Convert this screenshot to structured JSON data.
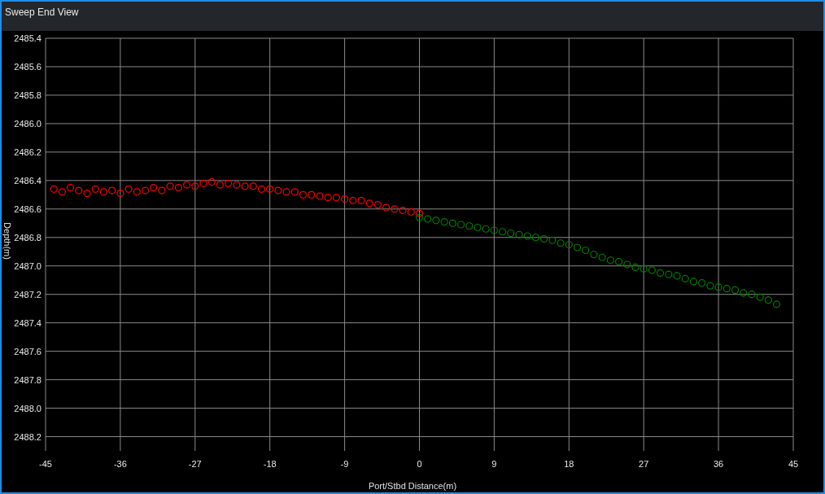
{
  "window": {
    "title": "Sweep End View"
  },
  "chart": {
    "chart_data": {
      "type": "scatter",
      "grid": true,
      "xlabel": "Port/Stbd Distance(m)",
      "ylabel": "Depth(m)",
      "xlim": [
        -45,
        45
      ],
      "ylim": [
        2488.3,
        2485.4
      ],
      "xticks": [
        -45,
        -36,
        -27,
        -18,
        -9,
        0,
        9,
        18,
        27,
        36,
        45
      ],
      "yticks": [
        {
          "value": 2485.4,
          "label": "2485.4"
        },
        {
          "value": 2485.6,
          "label": "2485.6"
        },
        {
          "value": 2485.8,
          "label": "2485.8"
        },
        {
          "value": 2486.0,
          "label": "2486.0"
        },
        {
          "value": 2486.2,
          "label": "2486.2"
        },
        {
          "value": 2486.4,
          "label": "2486.4"
        },
        {
          "value": 2486.6,
          "label": "2486.6"
        },
        {
          "value": 2486.8,
          "label": "2486.8"
        },
        {
          "value": 2487.0,
          "label": "2487.0"
        },
        {
          "value": 2487.2,
          "label": "2487.2"
        },
        {
          "value": 2487.4,
          "label": "2487.4"
        },
        {
          "value": 2487.6,
          "label": "2487.6"
        },
        {
          "value": 2487.8,
          "label": "2487.8"
        },
        {
          "value": 2488.0,
          "label": "2488.0"
        },
        {
          "value": 2488.2,
          "label": "2488.2"
        }
      ],
      "x": [
        -44,
        -43,
        -42,
        -41,
        -40,
        -39,
        -38,
        -37,
        -36,
        -35,
        -34,
        -33,
        -32,
        -31,
        -30,
        -29,
        -28,
        -27,
        -26,
        -25,
        -24,
        -23,
        -22,
        -21,
        -20,
        -19,
        -18,
        -17,
        -16,
        -15,
        -14,
        -13,
        -12,
        -11,
        -10,
        -9,
        -8,
        -7,
        -6,
        -5,
        -4,
        -3,
        -2,
        -1,
        0,
        1,
        2,
        3,
        4,
        5,
        6,
        7,
        8,
        9,
        10,
        11,
        12,
        13,
        14,
        15,
        16,
        17,
        18,
        19,
        20,
        21,
        22,
        23,
        24,
        25,
        26,
        27,
        28,
        29,
        30,
        31,
        32,
        33,
        34,
        35,
        36,
        37,
        38,
        39,
        40,
        41,
        42,
        43
      ],
      "series": [
        {
          "color": "#ff0000",
          "values": [
            2486.46,
            2486.48,
            2486.45,
            2486.47,
            2486.49,
            2486.46,
            2486.48,
            2486.47,
            2486.49,
            2486.46,
            2486.48,
            2486.47,
            2486.45,
            2486.47,
            2486.44,
            2486.45,
            2486.43,
            2486.44,
            2486.42,
            2486.41,
            2486.43,
            2486.42,
            2486.43,
            2486.44,
            2486.44,
            2486.46,
            2486.46,
            2486.47,
            2486.48,
            2486.48,
            2486.5,
            2486.5,
            2486.51,
            2486.52,
            2486.52,
            2486.53,
            2486.54,
            2486.54,
            2486.56,
            2486.57,
            2486.59,
            2486.6,
            2486.61,
            2486.62,
            2486.63,
            null,
            null,
            null,
            null,
            null,
            null,
            null,
            null,
            null,
            null,
            null,
            null,
            null,
            null,
            null,
            null,
            null,
            null,
            null,
            null,
            null,
            null,
            null,
            null,
            null,
            null,
            null,
            null,
            null,
            null,
            null,
            null,
            null,
            null,
            null,
            null,
            null,
            null,
            null,
            null,
            null,
            null,
            null
          ]
        },
        {
          "color": "#008000",
          "values": [
            null,
            null,
            null,
            null,
            null,
            null,
            null,
            null,
            null,
            null,
            null,
            null,
            null,
            null,
            null,
            null,
            null,
            null,
            null,
            null,
            null,
            null,
            null,
            null,
            null,
            null,
            null,
            null,
            null,
            null,
            null,
            null,
            null,
            null,
            null,
            null,
            null,
            null,
            null,
            null,
            null,
            null,
            null,
            null,
            2486.66,
            2486.67,
            2486.68,
            2486.69,
            2486.7,
            2486.71,
            2486.72,
            2486.73,
            2486.74,
            2486.75,
            2486.76,
            2486.77,
            2486.78,
            2486.79,
            2486.8,
            2486.81,
            2486.82,
            2486.84,
            2486.85,
            2486.87,
            2486.89,
            2486.92,
            2486.94,
            2486.96,
            2486.97,
            2486.99,
            2487.01,
            2487.02,
            2487.03,
            2487.05,
            2487.06,
            2487.07,
            2487.09,
            2487.11,
            2487.12,
            2487.14,
            2487.15,
            2487.16,
            2487.17,
            2487.19,
            2487.2,
            2487.22,
            2487.24,
            2487.27
          ]
        }
      ]
    }
  }
}
